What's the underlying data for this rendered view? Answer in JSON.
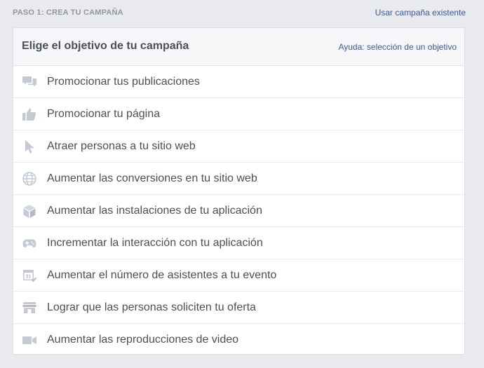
{
  "step": {
    "label": "PASO 1: CREA TU CAMPAÑA",
    "existing_link": "Usar campaña existente"
  },
  "panel": {
    "title": "Elige el objetivo de tu campaña",
    "help_link": "Ayuda: selección de un objetivo"
  },
  "objectives": [
    {
      "label": "Promocionar tus publicaciones",
      "icon": "speech-bubbles-icon"
    },
    {
      "label": "Promocionar tu página",
      "icon": "thumbs-up-icon"
    },
    {
      "label": "Atraer personas a tu sitio web",
      "icon": "cursor-icon"
    },
    {
      "label": "Aumentar las conversiones en tu sitio web",
      "icon": "globe-icon"
    },
    {
      "label": "Aumentar las instalaciones de tu aplicación",
      "icon": "box-icon"
    },
    {
      "label": "Incrementar la interacción con tu aplicación",
      "icon": "gamepad-icon"
    },
    {
      "label": "Aumentar el número de asistentes a tu evento",
      "icon": "calendar-icon",
      "icon_text": "31"
    },
    {
      "label": "Lograr que las personas soliciten tu oferta",
      "icon": "storefront-icon"
    },
    {
      "label": "Aumentar las reproducciones de video",
      "icon": "video-camera-icon"
    }
  ],
  "colors": {
    "icon": "#c4c9d2",
    "link": "#3b5998",
    "text": "#4b4f56",
    "background": "#e9eaed"
  }
}
